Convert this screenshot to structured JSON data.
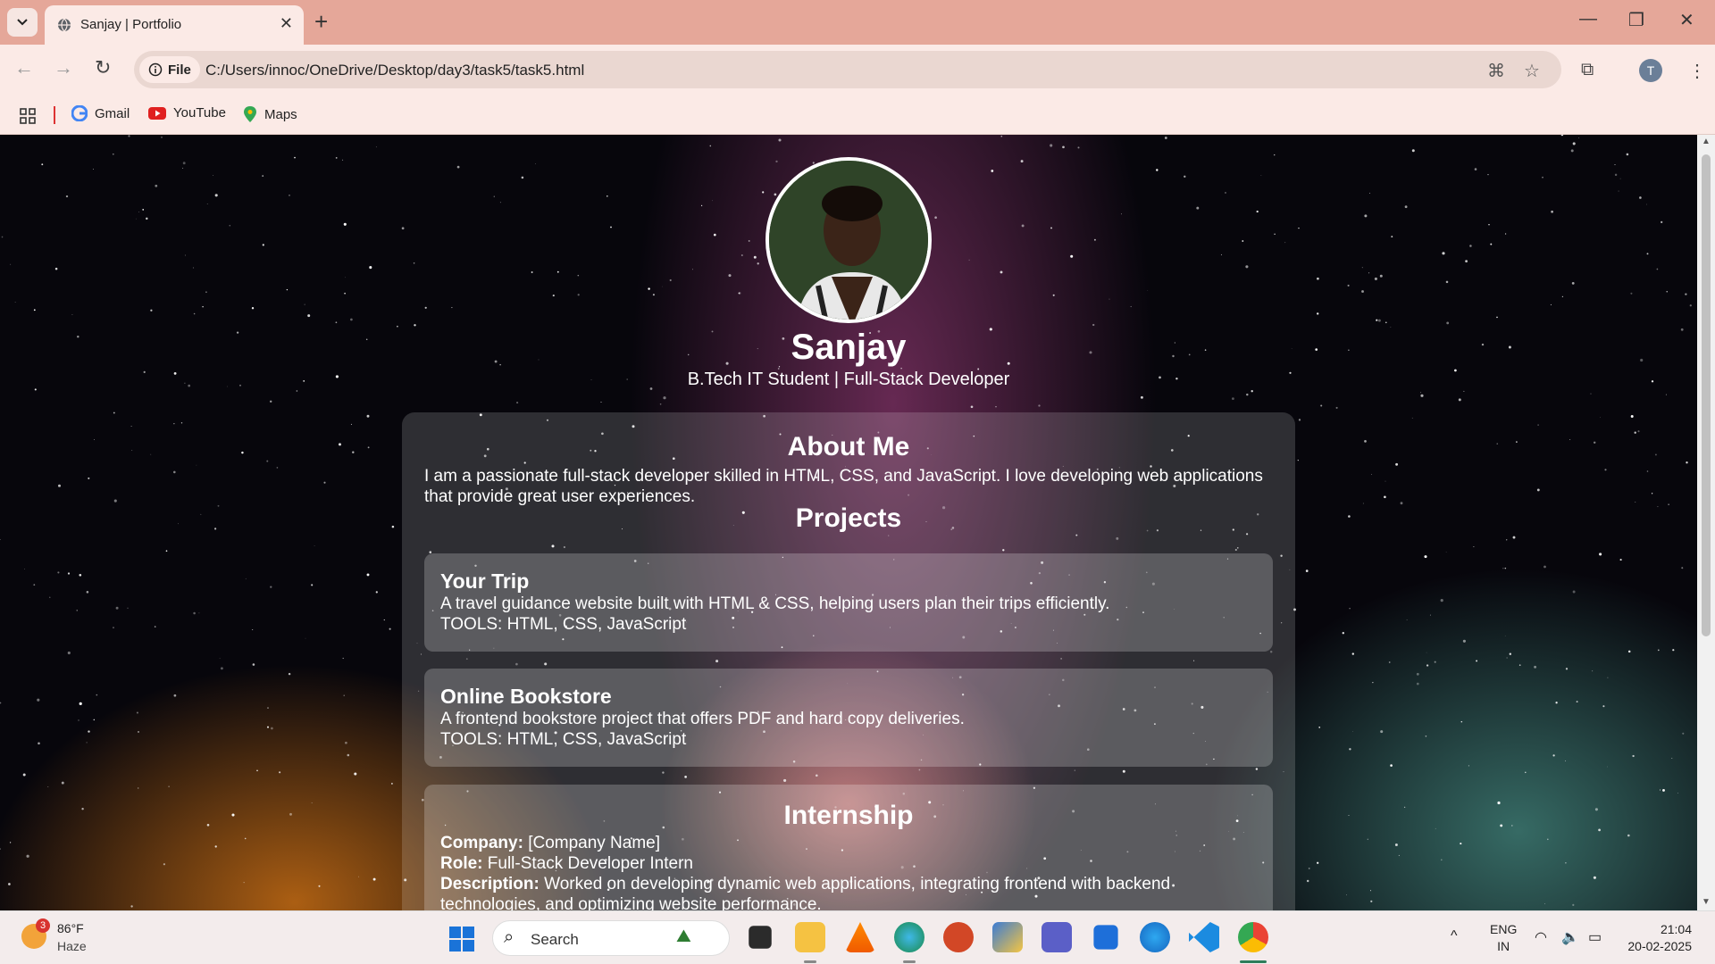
{
  "browser": {
    "tab_title": "Sanjay | Portfolio",
    "tab_close": "✕",
    "new_tab": "+",
    "file_chip": "File",
    "url": "C:/Users/innoc/OneDrive/Desktop/day3/task5/task5.html",
    "profile_initial": "T",
    "bookmarks": [
      {
        "label": "Gmail",
        "icon": "gmail-icon"
      },
      {
        "label": "YouTube",
        "icon": "youtube-icon"
      },
      {
        "label": "Maps",
        "icon": "maps-icon"
      }
    ]
  },
  "page": {
    "name": "Sanjay",
    "subtitle": "B.Tech IT Student | Full-Stack Developer",
    "about_title": "About Me",
    "about_text": "I am a passionate full-stack developer skilled in HTML, CSS, and JavaScript. I love developing web applications that provide great user experiences.",
    "projects_title": "Projects",
    "projects": [
      {
        "title": "Your Trip",
        "description": "A travel guidance website built with HTML & CSS, helping users plan their trips efficiently.",
        "tools": "TOOLS: HTML, CSS, JavaScript"
      },
      {
        "title": "Online Bookstore",
        "description": "A frontend bookstore project that offers PDF and hard copy deliveries.",
        "tools": "TOOLS: HTML, CSS, JavaScript"
      }
    ],
    "internship": {
      "title": "Internship",
      "company_label": "Company:",
      "company_value": "[Company Name]",
      "role_label": "Role:",
      "role_value": "Full-Stack Developer Intern",
      "description_label": "Description:",
      "description_value": "Worked on developing dynamic web applications, integrating frontend with backend technologies, and optimizing website performance."
    }
  },
  "taskbar": {
    "weather_badge": "3",
    "weather_temp": "86°F",
    "weather_condition": "Haze",
    "search_placeholder": "Search",
    "lang_top": "ENG",
    "lang_bottom": "IN",
    "time": "21:04",
    "date": "20-02-2025"
  },
  "colors": {
    "tabbar": "#e5a799",
    "toolbar": "#fbeae6",
    "start_blue": "#1a73d8"
  }
}
